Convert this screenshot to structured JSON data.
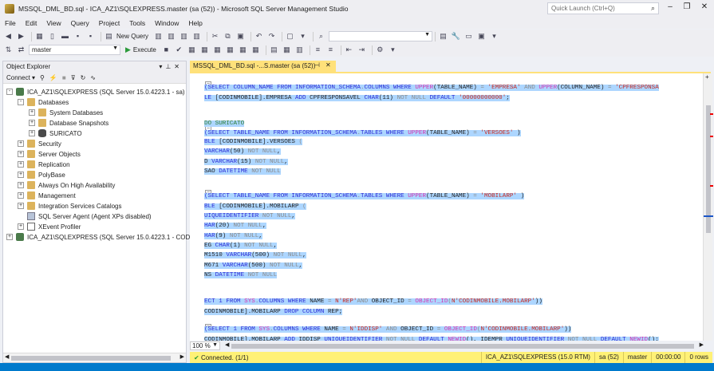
{
  "window": {
    "title": "MSSQL_DML_BD.sql - ICA_AZ1\\SQLEXPRESS.master (sa (52)) - Microsoft SQL Server Management Studio",
    "quick_launch_placeholder": "Quick Launch (Ctrl+Q)"
  },
  "menu": [
    "File",
    "Edit",
    "View",
    "Query",
    "Project",
    "Tools",
    "Window",
    "Help"
  ],
  "toolbar": {
    "new_query": "New Query",
    "database": "master",
    "execute": "Execute"
  },
  "object_explorer": {
    "title": "Object Explorer",
    "connect": "Connect",
    "nodes": [
      {
        "label": "ICA_AZ1\\SQLEXPRESS (SQL Server 15.0.4223.1 - sa)",
        "icon": "server-icon",
        "expand": "-"
      },
      {
        "label": "Databases",
        "icon": "folder-icon",
        "expand": "-"
      },
      {
        "label": "System Databases",
        "icon": "folder-icon",
        "expand": "+"
      },
      {
        "label": "Database Snapshots",
        "icon": "folder-icon",
        "expand": "+"
      },
      {
        "label": "SURICATO",
        "icon": "database-icon",
        "expand": "+"
      },
      {
        "label": "Security",
        "icon": "folder-icon",
        "expand": "+"
      },
      {
        "label": "Server Objects",
        "icon": "folder-icon",
        "expand": "+"
      },
      {
        "label": "Replication",
        "icon": "folder-icon",
        "expand": "+"
      },
      {
        "label": "PolyBase",
        "icon": "folder-icon",
        "expand": "+"
      },
      {
        "label": "Always On High Availability",
        "icon": "folder-icon",
        "expand": "+"
      },
      {
        "label": "Management",
        "icon": "folder-icon",
        "expand": "+"
      },
      {
        "label": "Integration Services Catalogs",
        "icon": "folder-icon",
        "expand": "+"
      },
      {
        "label": "SQL Server Agent (Agent XPs disabled)",
        "icon": "agent-icon",
        "expand": ""
      },
      {
        "label": "XEvent Profiler",
        "icon": "xevent-icon",
        "expand": "+"
      },
      {
        "label": "ICA_AZ1\\SQLEXPRESS (SQL Server 15.0.4223.1 - CODI",
        "icon": "server-icon",
        "expand": "+"
      }
    ]
  },
  "tab": {
    "label": "MSSQL_DML_BD.sql -...S.master (sa (52))"
  },
  "editor": {
    "lines": [
      {
        "parts": [
          [
            "(SELECT ",
            "kw"
          ],
          [
            "COLUMN_NAME ",
            "kw"
          ],
          [
            "FROM ",
            "kw"
          ],
          [
            "INFORMATION_SCHEMA",
            "kw"
          ],
          [
            ".",
            "gr"
          ],
          [
            "COLUMNS ",
            "kw"
          ],
          [
            "WHERE ",
            "kw"
          ],
          [
            "UPPER",
            "fn"
          ],
          [
            "(TABLE_NAME) ",
            ""
          ],
          [
            "= ",
            "gr"
          ],
          [
            "'EMPRESA' ",
            "str"
          ],
          [
            "AND ",
            "gr"
          ],
          [
            "UPPER",
            "fn"
          ],
          [
            "(COLUMN_NAME) ",
            ""
          ],
          [
            "= ",
            "gr"
          ],
          [
            "'CPFRESPONSA",
            "str"
          ]
        ]
      },
      {
        "parts": [
          [
            "LE ",
            "kw"
          ],
          [
            "[CODINMOBILE]",
            ""
          ],
          [
            ".EMPRESA ",
            ""
          ],
          [
            "ADD ",
            "kw"
          ],
          [
            "CPFRESPONSAVEL ",
            ""
          ],
          [
            "CHAR",
            "kw"
          ],
          [
            "(11) ",
            ""
          ],
          [
            "NOT NULL ",
            "gr"
          ],
          [
            "DEFAULT ",
            "kw"
          ],
          [
            "'00000000000'",
            "str"
          ],
          [
            ";",
            ""
          ]
        ]
      },
      {
        "parts": [
          [
            "DO SURICATO",
            "cm"
          ]
        ]
      },
      {
        "parts": [
          [
            "(SELECT ",
            "kw"
          ],
          [
            "TABLE_NAME ",
            "kw"
          ],
          [
            "FROM ",
            "kw"
          ],
          [
            "INFORMATION_SCHEMA",
            "kw"
          ],
          [
            ".",
            "gr"
          ],
          [
            "TABLES ",
            "kw"
          ],
          [
            "WHERE ",
            "kw"
          ],
          [
            "UPPER",
            "fn"
          ],
          [
            "(TABLE_NAME) ",
            ""
          ],
          [
            "= ",
            "gr"
          ],
          [
            "'VERSOES' ",
            "str"
          ],
          [
            ")",
            ""
          ]
        ]
      },
      {
        "parts": [
          [
            "BLE ",
            "kw"
          ],
          [
            "[CODINMOBILE]",
            ""
          ],
          [
            ".VERSOES ",
            ""
          ],
          [
            "(",
            "gr"
          ]
        ]
      },
      {
        "parts": [
          [
            "VARCHAR",
            "kw"
          ],
          [
            "(50) ",
            ""
          ],
          [
            "NOT NULL",
            "gr"
          ],
          [
            ",",
            ""
          ]
        ]
      },
      {
        "parts": [
          [
            "D ",
            ""
          ],
          [
            "VARCHAR",
            "kw"
          ],
          [
            "(15) ",
            ""
          ],
          [
            "NOT NULL",
            "gr"
          ],
          [
            ",",
            ""
          ]
        ]
      },
      {
        "parts": [
          [
            "SAO ",
            ""
          ],
          [
            "DATETIME ",
            "kw"
          ],
          [
            "NOT NULL",
            "gr"
          ]
        ]
      },
      {
        "parts": [
          [
            "(SELECT ",
            "kw"
          ],
          [
            "TABLE_NAME ",
            "kw"
          ],
          [
            "FROM ",
            "kw"
          ],
          [
            "INFORMATION_SCHEMA",
            "kw"
          ],
          [
            ".",
            "gr"
          ],
          [
            "TABLES ",
            "kw"
          ],
          [
            "WHERE ",
            "kw"
          ],
          [
            "UPPER",
            "fn"
          ],
          [
            "(TABLE_NAME) ",
            ""
          ],
          [
            "= ",
            "gr"
          ],
          [
            "'MOBILARP' ",
            "str"
          ],
          [
            ")",
            ""
          ]
        ]
      },
      {
        "parts": [
          [
            "BLE ",
            "kw"
          ],
          [
            "[CODINMOBILE]",
            ""
          ],
          [
            ".MOBILARP ",
            ""
          ],
          [
            "(",
            "gr"
          ]
        ]
      },
      {
        "parts": [
          [
            "UIQUEIDENTIFIER ",
            "kw"
          ],
          [
            "NOT NULL",
            "gr"
          ],
          [
            ",",
            ""
          ]
        ]
      },
      {
        "parts": [
          [
            "HAR",
            "kw"
          ],
          [
            "(20) ",
            ""
          ],
          [
            "NOT NULL",
            "gr"
          ],
          [
            ",",
            ""
          ]
        ]
      },
      {
        "parts": [
          [
            "HAR",
            "kw"
          ],
          [
            "(9) ",
            ""
          ],
          [
            "NOT NULL",
            "gr"
          ],
          [
            ",",
            ""
          ]
        ]
      },
      {
        "parts": [
          [
            "EG ",
            ""
          ],
          [
            "CHAR",
            "kw"
          ],
          [
            "(1) ",
            ""
          ],
          [
            "NOT NULL",
            "gr"
          ],
          [
            ",",
            ""
          ]
        ]
      },
      {
        "parts": [
          [
            "M1510 ",
            ""
          ],
          [
            "VARCHAR",
            "kw"
          ],
          [
            "(500) ",
            ""
          ],
          [
            "NOT NULL",
            "gr"
          ],
          [
            ",",
            ""
          ]
        ]
      },
      {
        "parts": [
          [
            "M671 ",
            ""
          ],
          [
            "VARCHAR",
            "kw"
          ],
          [
            "(500) ",
            ""
          ],
          [
            "NOT NULL",
            "gr"
          ],
          [
            ",",
            ""
          ]
        ]
      },
      {
        "parts": [
          [
            "NS ",
            ""
          ],
          [
            "DATETIME ",
            "kw"
          ],
          [
            "NOT NULL",
            "gr"
          ]
        ]
      },
      {
        "parts": [
          [
            "ECT 1 ",
            "kw"
          ],
          [
            "FROM ",
            "kw"
          ],
          [
            "SYS",
            "fn"
          ],
          [
            ".",
            "gr"
          ],
          [
            "COLUMNS ",
            "kw"
          ],
          [
            "WHERE ",
            "kw"
          ],
          [
            "NAME ",
            ""
          ],
          [
            "= ",
            "gr"
          ],
          [
            "N'REP'",
            "str"
          ],
          [
            "AND ",
            "gr"
          ],
          [
            "OBJECT_ID ",
            ""
          ],
          [
            "= ",
            "gr"
          ],
          [
            "OBJECT_ID",
            "fn"
          ],
          [
            "(",
            "gr"
          ],
          [
            "N'CODINMOBILE.MOBILARP'",
            "str"
          ],
          [
            "))",
            ""
          ]
        ]
      },
      {
        "parts": [
          [
            "CODINMOBILE]",
            ""
          ],
          [
            ".MOBILARP ",
            ""
          ],
          [
            "DROP COLUMN ",
            "kw"
          ],
          [
            "REP",
            ""
          ],
          [
            ";",
            ""
          ]
        ]
      },
      {
        "parts": [
          [
            "(SELECT 1 ",
            "kw"
          ],
          [
            "FROM ",
            "kw"
          ],
          [
            "SYS",
            "fn"
          ],
          [
            ".",
            "gr"
          ],
          [
            "COLUMNS ",
            "kw"
          ],
          [
            "WHERE ",
            "kw"
          ],
          [
            "NAME ",
            ""
          ],
          [
            "= ",
            "gr"
          ],
          [
            "N'IDDISP' ",
            "str"
          ],
          [
            "AND ",
            "gr"
          ],
          [
            "OBJECT_ID ",
            ""
          ],
          [
            "= ",
            "gr"
          ],
          [
            "OBJECT_ID",
            "fn"
          ],
          [
            "(",
            "gr"
          ],
          [
            "N'CODINMOBILE.MOBILARP'",
            "str"
          ],
          [
            "))",
            ""
          ]
        ]
      },
      {
        "parts": [
          [
            "CODINMOBILE]",
            ""
          ],
          [
            ".MOBILARP ",
            ""
          ],
          [
            "ADD ",
            "kw"
          ],
          [
            "IDDISP ",
            ""
          ],
          [
            "UNIQUEIDENTIFIER ",
            "kw"
          ],
          [
            "NOT NULL ",
            "gr"
          ],
          [
            "DEFAULT ",
            "kw"
          ],
          [
            "NEWID",
            "fn"
          ],
          [
            "(), ",
            ""
          ],
          [
            "IDEMPR ",
            ""
          ],
          [
            "UNIQUEIDENTIFIER ",
            "kw"
          ],
          [
            "NOT NULL ",
            "gr"
          ],
          [
            "DEFAULT ",
            "kw"
          ],
          [
            "NEWID",
            "fn"
          ],
          [
            "();",
            ""
          ]
        ]
      }
    ]
  },
  "zoom": "100 %",
  "status": {
    "connected": "Connected. (1/1)",
    "server": "ICA_AZ1\\SQLEXPRESS (15.0 RTM)",
    "user": "sa (52)",
    "database": "master",
    "elapsed": "00:00:00",
    "rows": "0 rows"
  },
  "colors": {
    "accent": "#007acc",
    "status_bar": "#fff176",
    "selection": "#add6ff",
    "tab_active": "#ffe17a"
  }
}
